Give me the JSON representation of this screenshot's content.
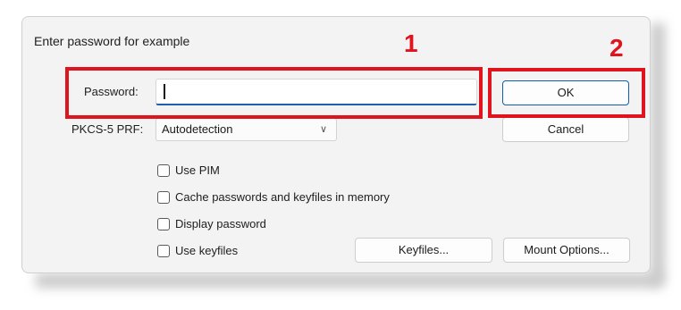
{
  "dialog": {
    "title": "Enter password for example",
    "password_label": "Password:",
    "password_value": "",
    "prf_label": "PKCS-5 PRF:",
    "prf_selected": "Autodetection",
    "ok_label": "OK",
    "cancel_label": "Cancel",
    "checkboxes": [
      {
        "label": "Use PIM",
        "checked": false
      },
      {
        "label": "Cache passwords and keyfiles in memory",
        "checked": false
      },
      {
        "label": "Display password",
        "checked": false
      },
      {
        "label": "Use keyfiles",
        "checked": false
      }
    ],
    "keyfiles_label": "Keyfiles...",
    "mount_options_label": "Mount Options..."
  },
  "annotations": {
    "marker_1": "1",
    "marker_2": "2",
    "highlight_color": "#e0141f"
  },
  "icons": {
    "dropdown": "chevron-down-icon"
  }
}
